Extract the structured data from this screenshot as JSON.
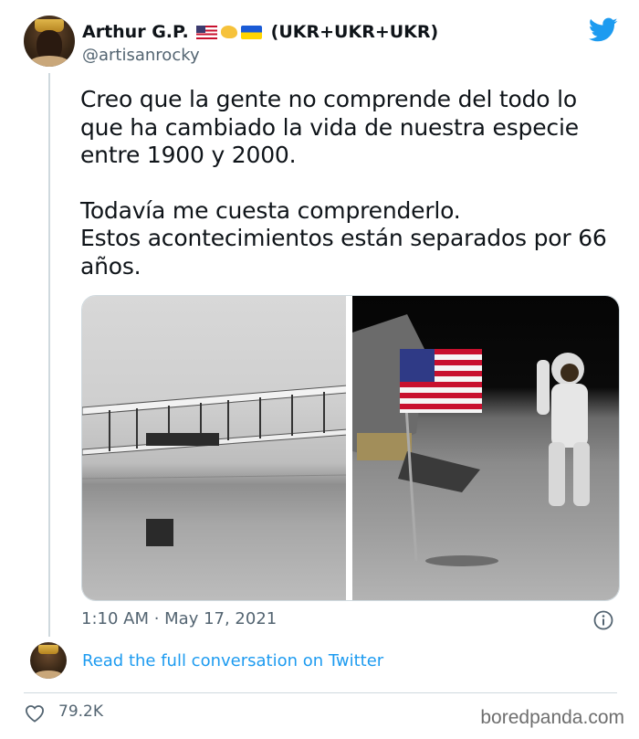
{
  "author": {
    "name": "Arthur G.P.",
    "name_suffix": "(UKR+UKR+UKR)",
    "handle": "@artisanrocky"
  },
  "tweet": {
    "paragraph_1": "Creo que la gente no comprende del todo lo que ha cambiado la vida de nuestra especie entre 1900 y 2000.",
    "paragraph_2_line_1": "Todavía me cuesta comprenderlo.",
    "paragraph_2_line_2": "Estos acontecimientos están separados por 66 años."
  },
  "media": {
    "left_photo": "wright-flyer-photo",
    "right_photo": "moon-landing-photo"
  },
  "meta": {
    "timestamp": "1:10 AM · May 17, 2021"
  },
  "footer": {
    "read_link": "Read the full conversation on Twitter",
    "likes": "79.2K",
    "watermark": "boredpanda.com"
  },
  "colors": {
    "link": "#1d9bf0",
    "muted": "#536471",
    "twitter_blue": "#1d9bf0"
  },
  "icons": [
    "twitter-bird-icon",
    "info-icon",
    "heart-icon"
  ]
}
